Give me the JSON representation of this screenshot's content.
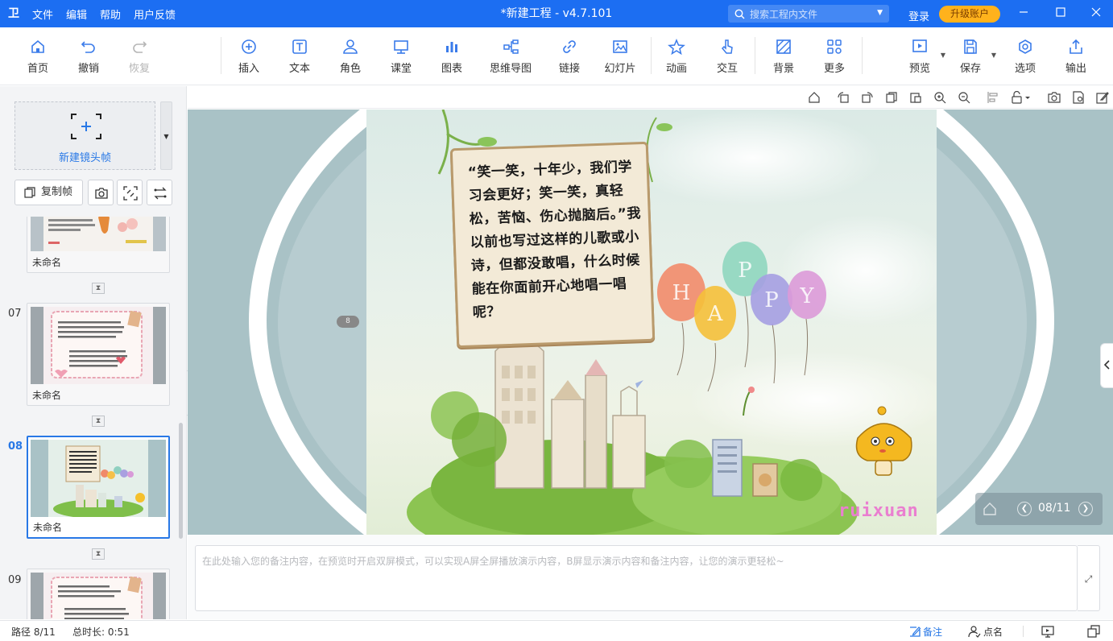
{
  "app": {
    "title": "*新建工程 - v4.7.101",
    "logo_glyph": "卫",
    "menu": [
      "文件",
      "编辑",
      "帮助",
      "用户反馈"
    ],
    "search_placeholder": "搜索工程内文件",
    "login": "登录",
    "upgrade": "升级账户",
    "window_controls": [
      "minimize-icon",
      "maximize-icon",
      "close-icon"
    ]
  },
  "toolbar": {
    "items": [
      {
        "label": "首页",
        "icon": "home-icon"
      },
      {
        "label": "撤销",
        "icon": "undo-icon"
      },
      {
        "label": "恢复",
        "icon": "redo-icon",
        "disabled": true
      },
      {
        "label": "插入",
        "icon": "insert-icon"
      },
      {
        "label": "文本",
        "icon": "text-icon"
      },
      {
        "label": "角色",
        "icon": "role-icon"
      },
      {
        "label": "课堂",
        "icon": "classroom-icon"
      },
      {
        "label": "图表",
        "icon": "chart-icon"
      },
      {
        "label": "思维导图",
        "icon": "mindmap-icon"
      },
      {
        "label": "链接",
        "icon": "link-icon"
      },
      {
        "label": "幻灯片",
        "icon": "slideshow-icon"
      },
      {
        "label": "动画",
        "icon": "animation-icon"
      },
      {
        "label": "交互",
        "icon": "interaction-icon"
      },
      {
        "label": "背景",
        "icon": "background-icon"
      },
      {
        "label": "更多",
        "icon": "more-icon"
      },
      {
        "label": "预览",
        "icon": "preview-icon"
      },
      {
        "label": "保存",
        "icon": "save-icon"
      },
      {
        "label": "选项",
        "icon": "options-icon"
      },
      {
        "label": "输出",
        "icon": "export-icon"
      }
    ]
  },
  "sidebar": {
    "new_frame": "新建镜头帧",
    "copy_frame": "复制帧",
    "slides": [
      {
        "num": "",
        "name": "未命名",
        "active": false
      },
      {
        "num": "07",
        "name": "未命名",
        "active": false
      },
      {
        "num": "08",
        "name": "未命名",
        "active": true
      },
      {
        "num": "09",
        "name": "",
        "active": false
      }
    ]
  },
  "slide": {
    "text": "“笑一笑，十年少，我们学习会更好；笑一笑，真轻松，苦恼、伤心抛脑后。”我以前也写过这样的儿歌或小诗，但都没敢唱，什么时候能在你面前开心地唱一唱呢？",
    "badge": "8",
    "watermark": "ruixuan",
    "balloons": [
      "H",
      "A",
      "P",
      "P",
      "Y"
    ]
  },
  "nav": {
    "counter": "08/11"
  },
  "notes": {
    "placeholder": "在此处输入您的备注内容，在预览时开启双屏模式，可以实现A屏全屏播放演示内容，B屏显示演示内容和备注内容，让您的演示更轻松~"
  },
  "status": {
    "path": "路径 8/11",
    "duration": "总时长: 0:51",
    "notes": "备注",
    "rollcall": "点名"
  },
  "colors": {
    "accent": "#1c6ef2",
    "upgrade": "#ffb21c",
    "active_blue": "#2878e6"
  }
}
